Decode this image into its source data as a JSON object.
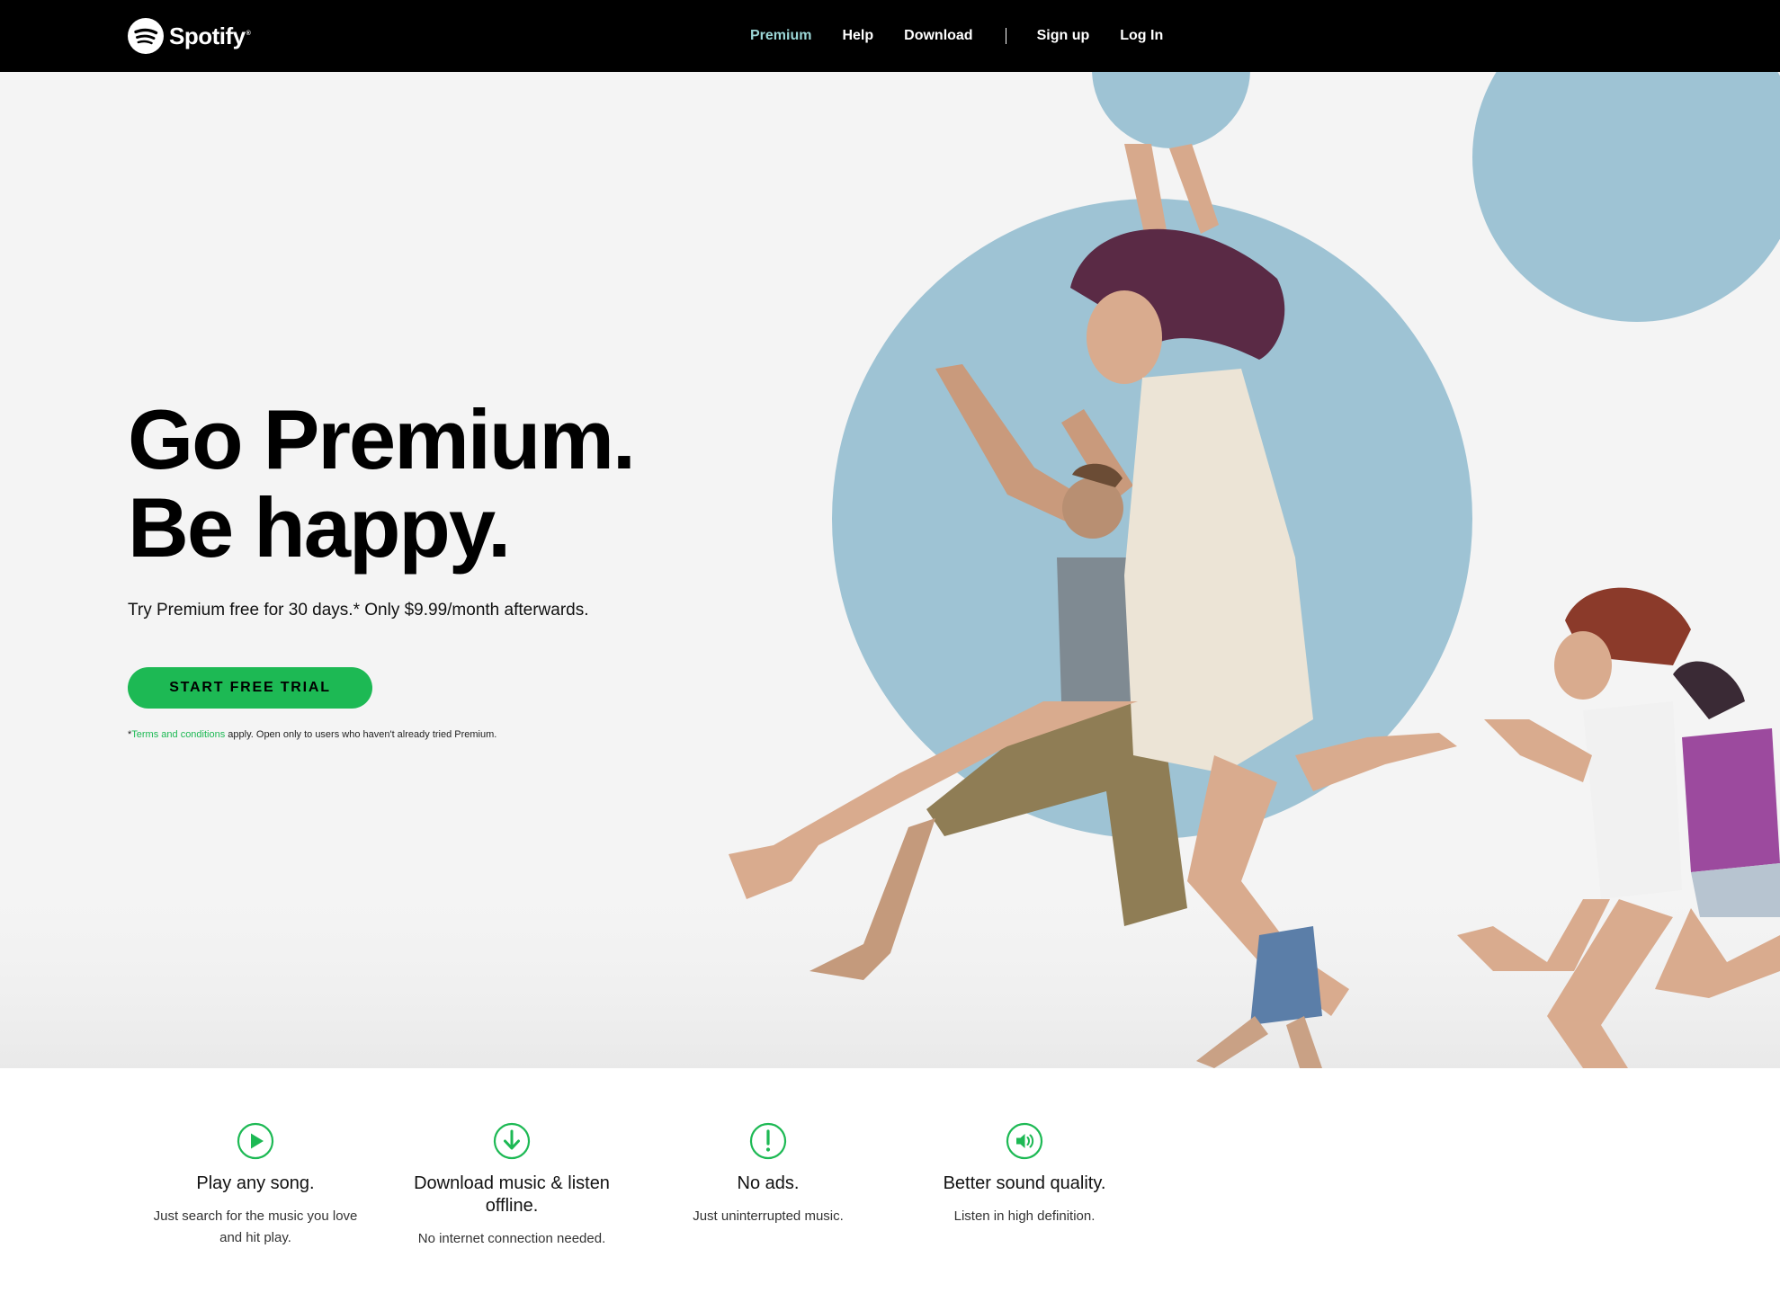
{
  "brand": {
    "name": "Spotify",
    "trademark": "®"
  },
  "nav": {
    "links": [
      {
        "label": "Premium",
        "active": true
      },
      {
        "label": "Help"
      },
      {
        "label": "Download"
      },
      {
        "label": "Sign up"
      },
      {
        "label": "Log In"
      }
    ]
  },
  "hero": {
    "headline_line1": "Go Premium.",
    "headline_line2": "Be happy.",
    "subhead": "Try Premium free for 30 days.* Only $9.99/month afterwards.",
    "cta_label": "START FREE TRIAL",
    "fine_print_prefix": "*",
    "terms_link": "Terms and conditions",
    "fine_print_suffix": " apply. Open only to users who haven't already tried Premium."
  },
  "features": [
    {
      "icon": "play-icon",
      "title": "Play any song.",
      "description": "Just search for the music you love and hit play."
    },
    {
      "icon": "download-icon",
      "title": "Download music & listen offline.",
      "description": "No internet connection needed."
    },
    {
      "icon": "no-ads-icon",
      "title": "No ads.",
      "description": "Just uninterrupted music."
    },
    {
      "icon": "speaker-icon",
      "title": "Better sound quality.",
      "description": "Listen in high definition."
    }
  ],
  "colors": {
    "accent": "#1db954",
    "nav_bg": "#000000",
    "hero_bg": "#f4f4f4",
    "circle": "#9ec3d4",
    "active_nav": "#9bd6d6"
  }
}
